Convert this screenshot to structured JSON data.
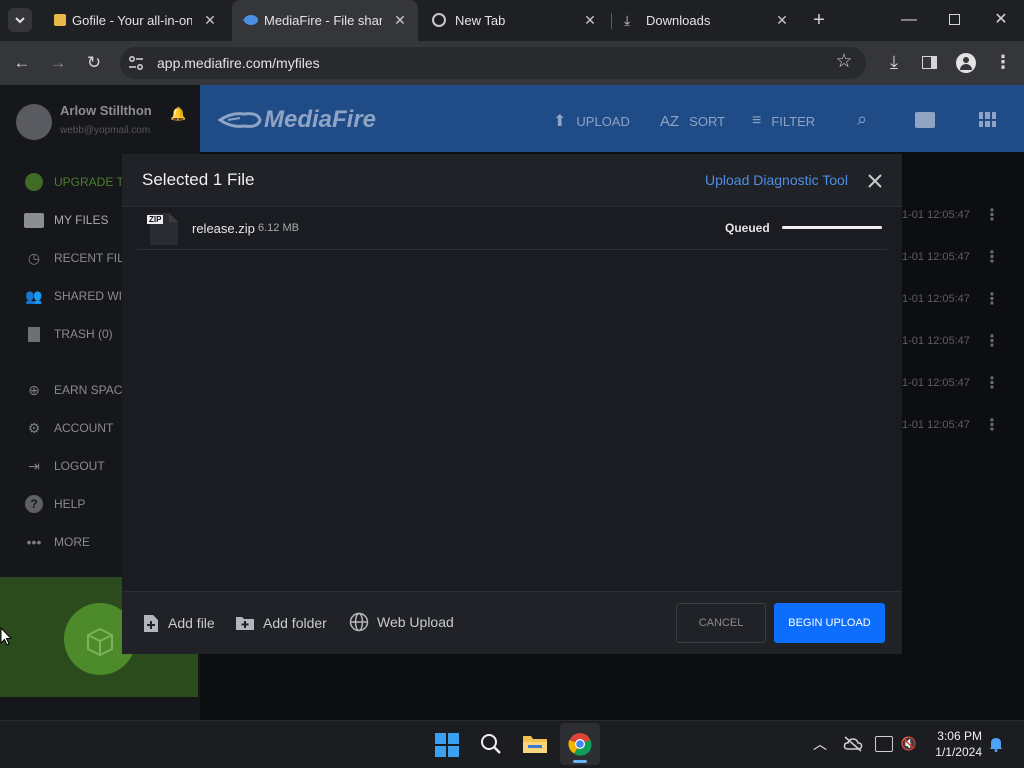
{
  "browser": {
    "tabs": [
      {
        "title": "Gofile - Your all-in-one"
      },
      {
        "title": "MediaFire - File sharing"
      },
      {
        "title": "New Tab"
      },
      {
        "title": "Downloads"
      }
    ],
    "url": "app.mediafire.com/myfiles"
  },
  "sidebar": {
    "user_name": "Arlow Stillthon",
    "user_email": "webb@yopmail.com",
    "items": [
      {
        "label": "UPGRADE TO"
      },
      {
        "label": "MY FILES"
      },
      {
        "label": "RECENT FILE"
      },
      {
        "label": "SHARED WIT"
      },
      {
        "label": "TRASH (0)"
      },
      {
        "label": "EARN SPACE"
      },
      {
        "label": "ACCOUNT"
      },
      {
        "label": "LOGOUT"
      },
      {
        "label": "HELP"
      },
      {
        "label": "MORE"
      }
    ]
  },
  "header": {
    "logo_text": "MediaFire",
    "upload": "UPLOAD",
    "sort": "SORT",
    "sort_glyph": "AZ",
    "filter": "FILTER"
  },
  "rows": {
    "date": "1-01 12:05:47"
  },
  "modal": {
    "title": "Selected 1 File",
    "diagnostic_link": "Upload Diagnostic Tool",
    "file": {
      "badge": "ZIP",
      "name": "release.zip",
      "size": "6.12 MB",
      "status": "Queued",
      "progress": 1.0
    },
    "add_file": "Add file",
    "add_folder": "Add folder",
    "web_upload": "Web Upload",
    "cancel": "CANCEL",
    "begin_upload": "BEGIN UPLOAD"
  },
  "taskbar": {
    "time": "3:06 PM",
    "date": "1/1/2024"
  },
  "colors": {
    "accent_blue": "#0d6efd",
    "header_blue": "#1f4b87",
    "link_blue": "#4d8fe6"
  }
}
